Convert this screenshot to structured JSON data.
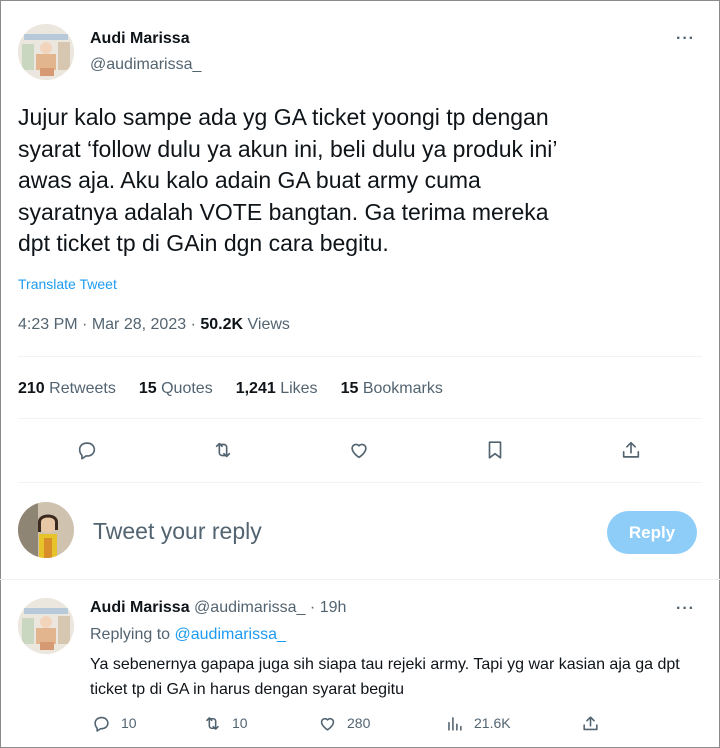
{
  "tweet": {
    "author_name": "Audi Marissa",
    "author_handle": "@audimarissa_",
    "text": "Jujur kalo sampe ada yg GA ticket yoongi tp dengan\nsyarat ‘follow dulu ya akun ini, beli dulu ya produk ini’\nawas aja. Aku kalo adain GA buat army cuma\nsyaratnya adalah VOTE bangtan. Ga terima mereka\ndpt ticket tp di GAin dgn cara begitu.",
    "translate_label": "Translate Tweet",
    "time": "4:23 PM",
    "separator": "·",
    "date": "Mar 28, 2023",
    "views_count": "50.2K",
    "views_label": "Views",
    "more_label": "···"
  },
  "stats": [
    {
      "count": "210",
      "label": "Retweets"
    },
    {
      "count": "15",
      "label": "Quotes"
    },
    {
      "count": "1,241",
      "label": "Likes"
    },
    {
      "count": "15",
      "label": "Bookmarks"
    }
  ],
  "actions": {
    "icons": [
      "reply-icon",
      "retweet-icon",
      "like-icon",
      "bookmark-icon",
      "share-icon"
    ]
  },
  "composer": {
    "placeholder": "Tweet your reply",
    "button_label": "Reply"
  },
  "reply": {
    "author_name": "Audi Marissa",
    "author_handle": "@audimarissa_",
    "separator": "·",
    "age": "19h",
    "replying_prefix": "Replying to",
    "replying_to": "@audimarissa_",
    "text": "Ya sebenernya gapapa juga sih siapa tau rejeki army. Tapi yg war kasian aja ga dpt ticket tp di GA in harus dengan syarat begitu",
    "replies": "10",
    "retweets": "10",
    "likes": "280",
    "views": "21.6K",
    "more_label": "···"
  },
  "colors": {
    "accent": "#1d9bf0",
    "secondary_text": "#536471",
    "reply_button_disabled": "#8ecdf8"
  }
}
